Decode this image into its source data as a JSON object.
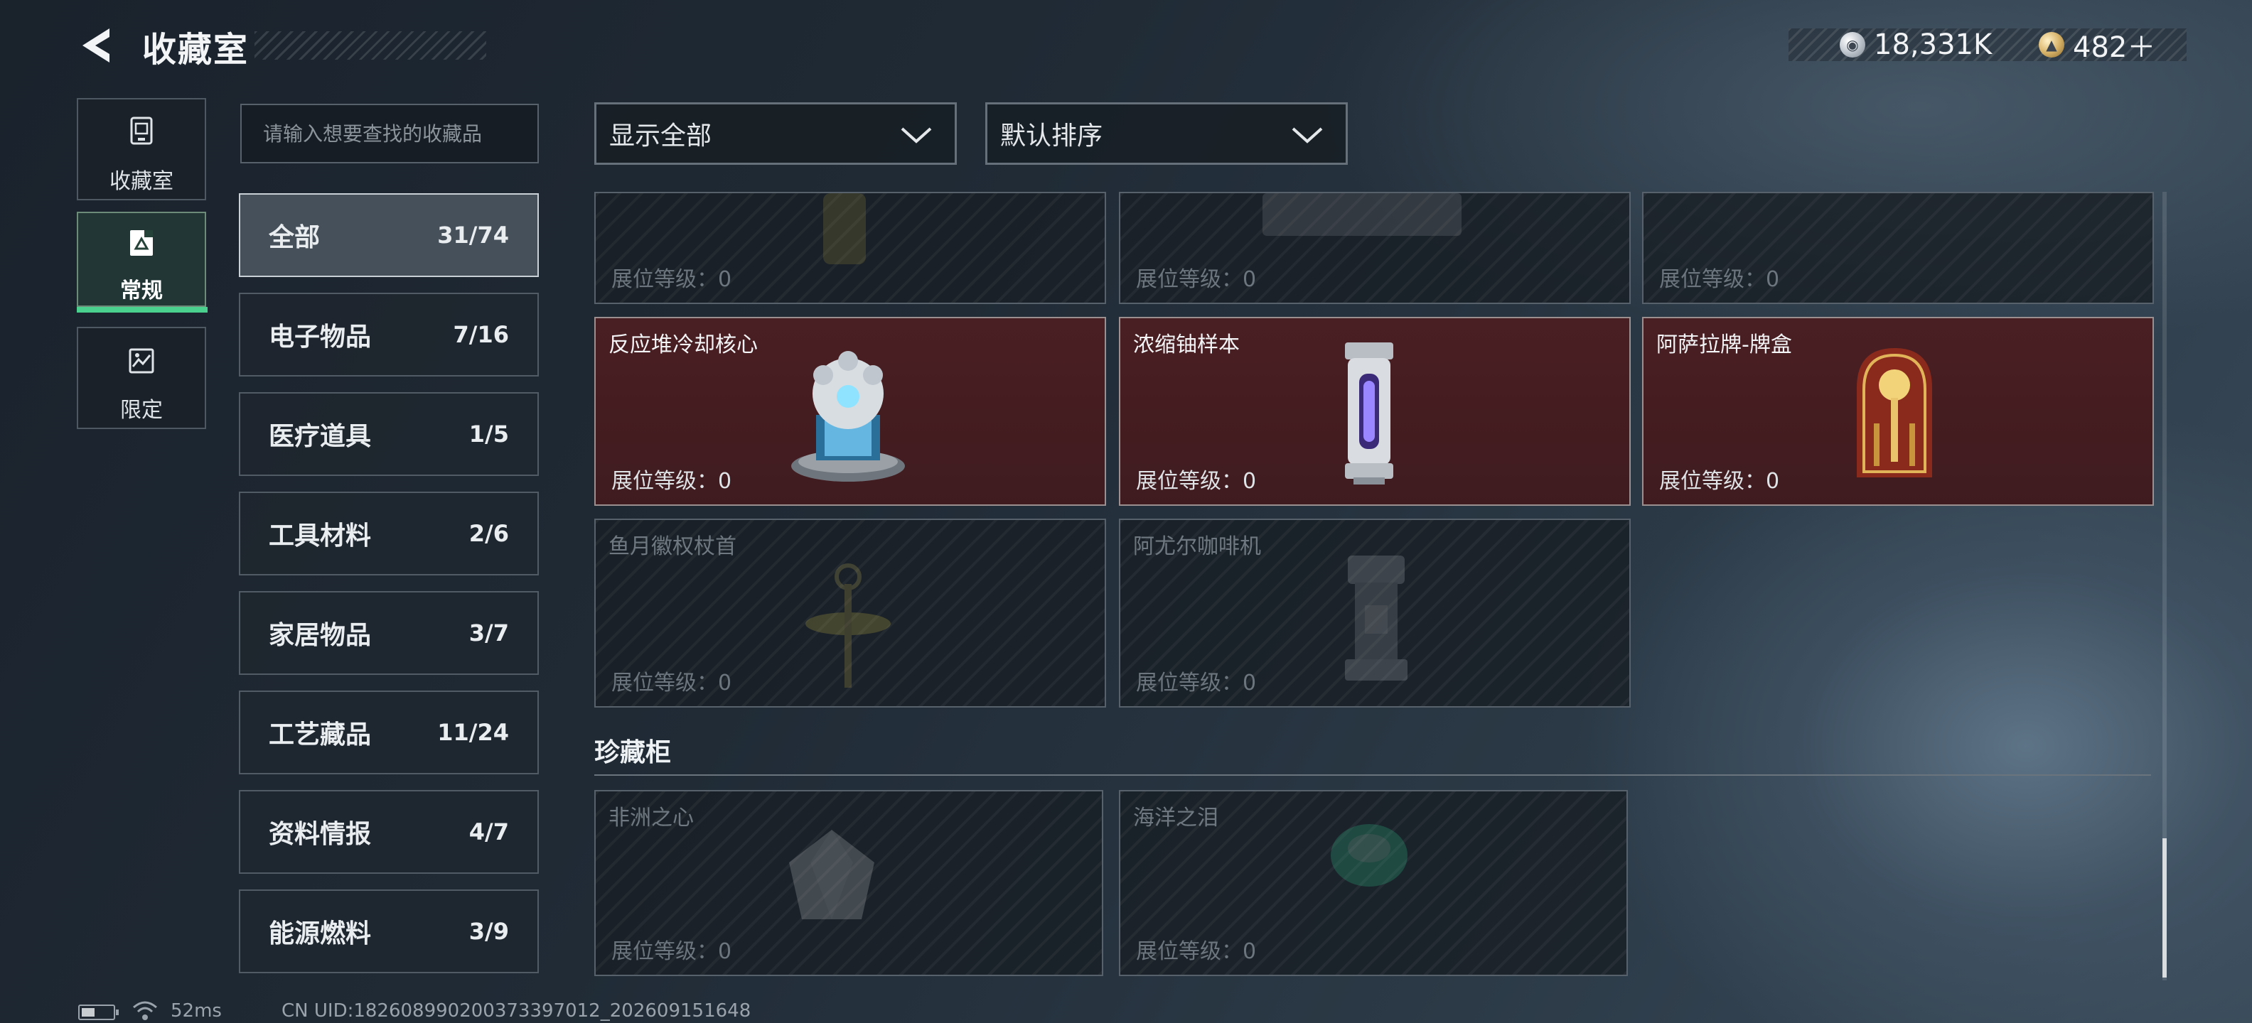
{
  "header": {
    "title": "收藏室",
    "currency_silver": "18,331K",
    "currency_gold": "482＋"
  },
  "side_nav": [
    {
      "label": "收藏室",
      "icon": "collection-room-icon",
      "active": false
    },
    {
      "label": "常规",
      "icon": "regular-icon",
      "active": true
    },
    {
      "label": "限定",
      "icon": "limited-icon",
      "active": false
    }
  ],
  "search": {
    "placeholder": "请输入想要查找的收藏品"
  },
  "filters": {
    "display_selected": "显示全部",
    "sort_selected": "默认排序"
  },
  "categories": [
    {
      "name": "全部",
      "count": "31/74",
      "active": true
    },
    {
      "name": "电子物品",
      "count": "7/16"
    },
    {
      "name": "医疗道具",
      "count": "1/5"
    },
    {
      "name": "工具材料",
      "count": "2/6"
    },
    {
      "name": "家居物品",
      "count": "3/7"
    },
    {
      "name": "工艺藏品",
      "count": "11/24"
    },
    {
      "name": "资料情报",
      "count": "4/7"
    },
    {
      "name": "能源燃料",
      "count": "3/9"
    }
  ],
  "grid": {
    "row_partial": [
      {
        "name": "",
        "level": "展位等级：0"
      },
      {
        "name": "",
        "level": "展位等级：0"
      },
      {
        "name": "",
        "level": "展位等级：0"
      }
    ],
    "row_collected": [
      {
        "name": "反应堆冷却核心",
        "level": "展位等级：0",
        "icon": "reactor-core-icon"
      },
      {
        "name": "浓缩铀样本",
        "level": "展位等级：0",
        "icon": "uranium-canister-icon"
      },
      {
        "name": "阿萨拉牌-牌盒",
        "level": "展位等级：0",
        "icon": "card-box-icon"
      }
    ],
    "row_locked": [
      {
        "name": "鱼月徽权杖首",
        "level": "展位等级：0",
        "icon": "scepter-head-icon"
      },
      {
        "name": "阿尤尔咖啡机",
        "level": "展位等级：0",
        "icon": "coffee-machine-icon"
      }
    ]
  },
  "cabinet": {
    "title": "珍藏柜",
    "items": [
      {
        "name": "非洲之心",
        "level": "展位等级：0",
        "icon": "diamond-icon"
      },
      {
        "name": "海洋之泪",
        "level": "展位等级：0",
        "icon": "gem-icon"
      }
    ]
  },
  "footer": {
    "ping": "52ms",
    "uid": "CN UID:18260899020037339701​2_202609151648"
  }
}
